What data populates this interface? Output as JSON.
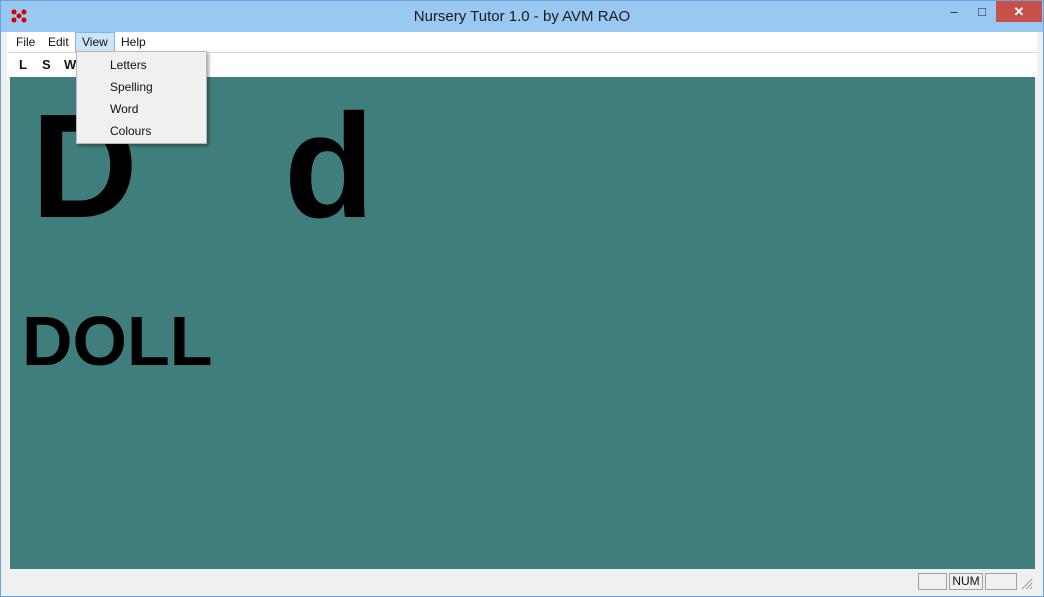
{
  "window": {
    "title": "Nursery Tutor 1.0 - by AVM RAO",
    "minimize_label": "–",
    "maximize_label": "□",
    "close_label": "✕"
  },
  "menubar": {
    "items": [
      {
        "label": "File"
      },
      {
        "label": "Edit"
      },
      {
        "label": "View"
      },
      {
        "label": "Help"
      }
    ]
  },
  "toolbar": {
    "buttons": [
      {
        "label": "L"
      },
      {
        "label": "S"
      },
      {
        "label": "W"
      }
    ]
  },
  "view_menu": {
    "items": [
      {
        "label": "Letters"
      },
      {
        "label": "Spelling"
      },
      {
        "label": "Word"
      },
      {
        "label": "Colours"
      }
    ]
  },
  "lesson": {
    "upper_letter": "D",
    "lower_letter": "d",
    "word": "DOLL",
    "background_color": "#407e7d"
  },
  "statusbar": {
    "panels": [
      {
        "label": ""
      },
      {
        "label": "NUM"
      },
      {
        "label": ""
      }
    ]
  }
}
